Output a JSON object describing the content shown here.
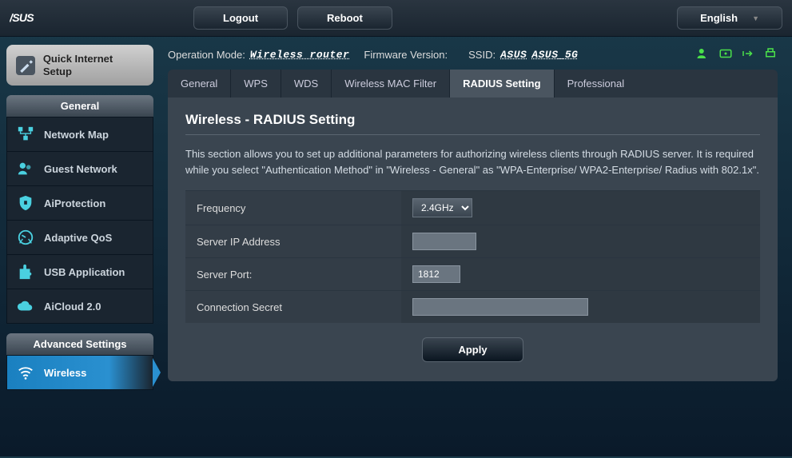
{
  "topbar": {
    "logout": "Logout",
    "reboot": "Reboot",
    "language": "English"
  },
  "sidebar": {
    "qis": "Quick Internet Setup",
    "general_header": "General",
    "general_items": [
      {
        "label": "Network Map"
      },
      {
        "label": "Guest Network"
      },
      {
        "label": "AiProtection"
      },
      {
        "label": "Adaptive QoS"
      },
      {
        "label": "USB Application"
      },
      {
        "label": "AiCloud 2.0"
      }
    ],
    "advanced_header": "Advanced Settings",
    "advanced_items": [
      {
        "label": "Wireless"
      }
    ]
  },
  "info": {
    "opmode_label": "Operation Mode:",
    "opmode_value": "Wireless router",
    "fw_label": "Firmware Version:",
    "ssid_label": "SSID:",
    "ssid1": "ASUS",
    "ssid2": "ASUS_5G"
  },
  "tabs": [
    {
      "label": "General"
    },
    {
      "label": "WPS"
    },
    {
      "label": "WDS"
    },
    {
      "label": "Wireless MAC Filter"
    },
    {
      "label": "RADIUS Setting"
    },
    {
      "label": "Professional"
    }
  ],
  "panel": {
    "title": "Wireless - RADIUS Setting",
    "desc": "This section allows you to set up additional parameters for authorizing wireless clients through RADIUS server. It is required while you select \"Authentication Method\" in \"Wireless - General\" as \"WPA-Enterprise/ WPA2-Enterprise/ Radius with 802.1x\"."
  },
  "form": {
    "frequency_label": "Frequency",
    "frequency_value": "2.4GHz",
    "server_ip_label": "Server IP Address",
    "server_ip_value": "",
    "server_port_label": "Server Port:",
    "server_port_value": "1812",
    "secret_label": "Connection Secret",
    "secret_value": "",
    "apply": "Apply"
  },
  "colors": {
    "accent_cyan": "#4ad0e0",
    "accent_green": "#4ae04a"
  }
}
